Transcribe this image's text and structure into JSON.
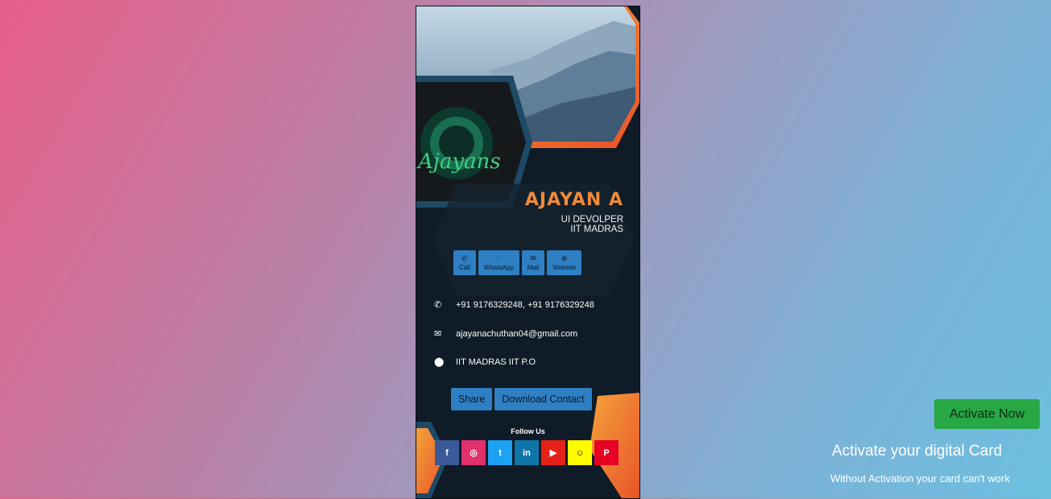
{
  "card": {
    "logo_text": "Ajayans",
    "name": "AJAYAN A",
    "role_line1": "UI DEVOLPER",
    "role_line2": "IIT MADRAS",
    "actions": [
      {
        "label": "Call",
        "icon": "phone-icon"
      },
      {
        "label": "WhatsApp",
        "icon": "whatsapp-icon"
      },
      {
        "label": "Mail",
        "icon": "mail-icon"
      },
      {
        "label": "Website",
        "icon": "globe-icon"
      }
    ],
    "phone": "+91 9176329248, +91 9176329248",
    "email": "ajayanachuthan04@gmail.com",
    "address": "IIT MADRAS IIT P.O",
    "share_label": "Share",
    "download_label": "Download Contact",
    "follow_label": "Follow Us",
    "social": [
      {
        "name": "facebook",
        "glyph": "f",
        "color": "#3b5998"
      },
      {
        "name": "instagram",
        "glyph": "◎",
        "color": "#e1306c"
      },
      {
        "name": "twitter",
        "glyph": "t",
        "color": "#1da1f2"
      },
      {
        "name": "linkedin",
        "glyph": "in",
        "color": "#0e76a8"
      },
      {
        "name": "youtube",
        "glyph": "▶",
        "color": "#e62117"
      },
      {
        "name": "snapchat",
        "glyph": "☺",
        "color": "#fffc00"
      },
      {
        "name": "pinterest",
        "glyph": "P",
        "color": "#e60023"
      }
    ]
  },
  "activation": {
    "button_label": "Activate Now",
    "title": "Activate your digital Card",
    "subtitle": "Without Activation your card can't work"
  },
  "colors": {
    "accent_orange": "#f08a3c",
    "button_blue": "#2f7fc4",
    "activate_green": "#28a745"
  }
}
